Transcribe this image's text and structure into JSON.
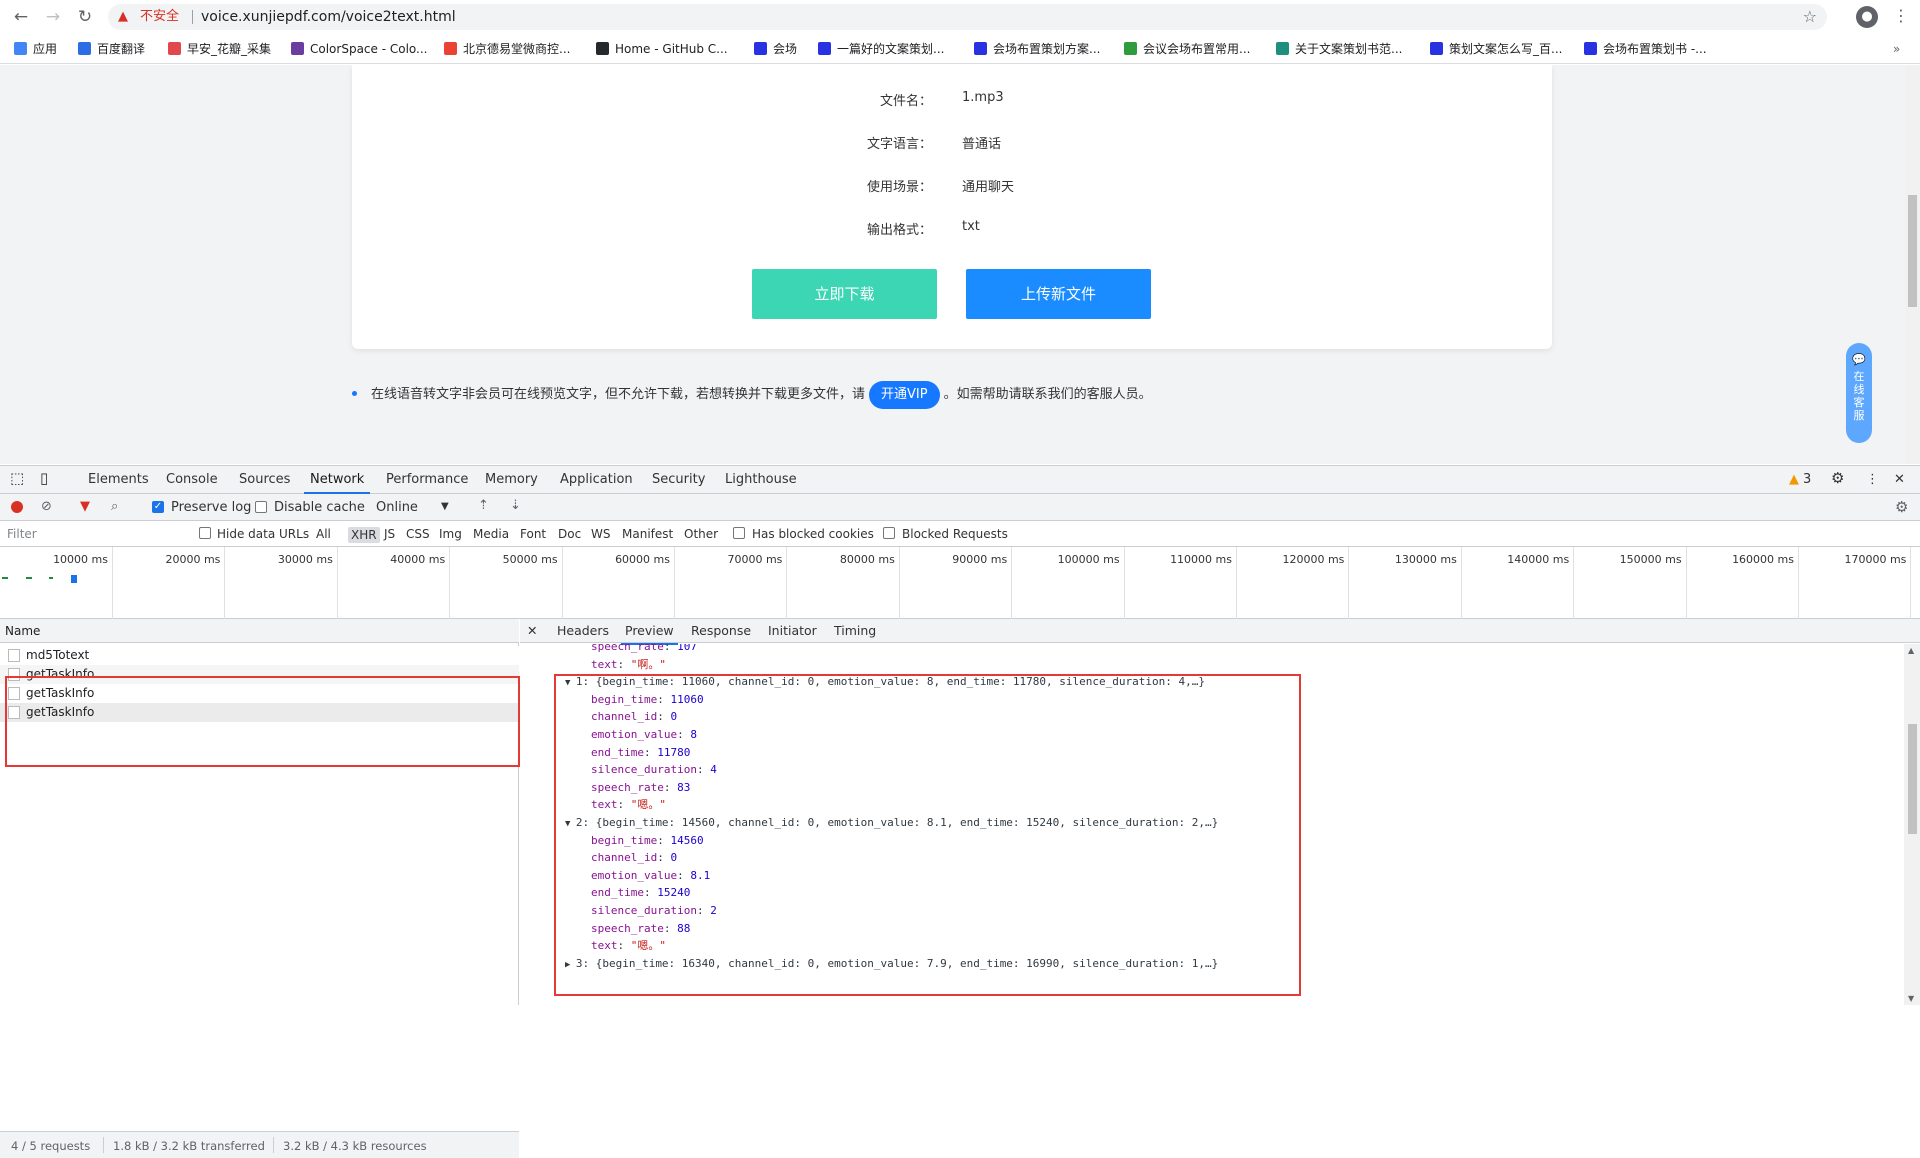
{
  "browser": {
    "not_secure": "不安全",
    "url": "voice.xunjiepdf.com/voice2text.html"
  },
  "bookmarks": [
    {
      "label": "应用",
      "icon": "apps-grid-icon",
      "color": "#4285f4"
    },
    {
      "label": "百度翻译",
      "icon": "baidu-translate-icon",
      "color": "#2b6de5"
    },
    {
      "label": "早安_花瓣_采集",
      "icon": "huaban-icon",
      "color": "#e0484d"
    },
    {
      "label": "ColorSpace - Colo...",
      "icon": "colorspace-icon",
      "color": "#6a3ea1"
    },
    {
      "label": "北京德易堂微商控...",
      "icon": "google-icon",
      "color": "#ea4335"
    },
    {
      "label": "Home - GitHub C...",
      "icon": "github-icon",
      "color": "#24292e"
    },
    {
      "label": "会场",
      "icon": "baidu-paw-icon",
      "color": "#2932e1"
    },
    {
      "label": "一篇好的文案策划...",
      "icon": "baidu-paw-icon",
      "color": "#2932e1"
    },
    {
      "label": "会场布置策划方案...",
      "icon": "baidu-paw-icon",
      "color": "#2932e1"
    },
    {
      "label": "会议会场布置常用...",
      "icon": "doc-green-icon",
      "color": "#2e9c3a"
    },
    {
      "label": "关于文案策划书范...",
      "icon": "doc-teal-icon",
      "color": "#1f8f7d"
    },
    {
      "label": "策划文案怎么写_百...",
      "icon": "baidu-paw-icon",
      "color": "#2932e1"
    },
    {
      "label": "会场布置策划书 -...",
      "icon": "baidu-paw-icon",
      "color": "#2932e1"
    }
  ],
  "card": {
    "rows": [
      {
        "label": "文件名：",
        "value": "1.mp3"
      },
      {
        "label": "文字语言：",
        "value": "普通话"
      },
      {
        "label": "使用场景：",
        "value": "通用聊天"
      },
      {
        "label": "输出格式：",
        "value": "txt"
      }
    ],
    "download_label": "立即下载",
    "upload_label": "上传新文件",
    "download_color": "#3dd6b4",
    "upload_color": "#1a8cff"
  },
  "notice": {
    "before": "在线语音转文字非会员可在线预览文字，但不允许下载，若想转换并下载更多文件，请",
    "vip": "开通VIP",
    "after": "。如需帮助请联系我们的客服人员。"
  },
  "service": {
    "label": "在线客服"
  },
  "devtools": {
    "tabs": [
      "Elements",
      "Console",
      "Sources",
      "Network",
      "Performance",
      "Memory",
      "Application",
      "Security",
      "Lighthouse"
    ],
    "active_tab": "Network",
    "warning_count": "3",
    "preserve_log": "Preserve log",
    "disable_cache": "Disable cache",
    "throttle": "Online",
    "filter_placeholder": "Filter",
    "hide_data_urls": "Hide data URLs",
    "filter_types": [
      "All",
      "XHR",
      "JS",
      "CSS",
      "Img",
      "Media",
      "Font",
      "Doc",
      "WS",
      "Manifest",
      "Other"
    ],
    "has_blocked_cookies": "Has blocked cookies",
    "blocked_requests": "Blocked Requests",
    "timeline_ticks": [
      "10000 ms",
      "20000 ms",
      "30000 ms",
      "40000 ms",
      "50000 ms",
      "60000 ms",
      "70000 ms",
      "80000 ms",
      "90000 ms",
      "100000 ms",
      "110000 ms",
      "120000 ms",
      "130000 ms",
      "140000 ms",
      "150000 ms",
      "160000 ms",
      "170000 ms"
    ],
    "name_header": "Name",
    "requests": [
      "md5Totext",
      "getTaskInfo",
      "getTaskInfo",
      "getTaskInfo"
    ],
    "status": {
      "requests": "4 / 5 requests",
      "transferred": "1.8 kB / 3.2 kB transferred",
      "resources": "3.2 kB / 4.3 kB resources"
    },
    "detail_tabs": [
      "Headers",
      "Preview",
      "Response",
      "Initiator",
      "Timing"
    ],
    "active_detail_tab": "Preview",
    "preview": {
      "prev_tail": [
        {
          "key": "speech_rate",
          "value": "107",
          "kind": "n"
        },
        {
          "key": "text",
          "value": "\"啊。\"",
          "kind": "s"
        }
      ],
      "items": [
        {
          "summary": "1: {begin_time: 11060, channel_id: 0, emotion_value: 8, end_time: 11780, silence_duration: 4,…}",
          "fields": [
            {
              "key": "begin_time",
              "value": "11060",
              "kind": "n"
            },
            {
              "key": "channel_id",
              "value": "0",
              "kind": "n"
            },
            {
              "key": "emotion_value",
              "value": "8",
              "kind": "n"
            },
            {
              "key": "end_time",
              "value": "11780",
              "kind": "n"
            },
            {
              "key": "silence_duration",
              "value": "4",
              "kind": "n"
            },
            {
              "key": "speech_rate",
              "value": "83",
              "kind": "n"
            },
            {
              "key": "text",
              "value": "\"嗯。\"",
              "kind": "s"
            }
          ]
        },
        {
          "summary": "2: {begin_time: 14560, channel_id: 0, emotion_value: 8.1, end_time: 15240, silence_duration: 2,…}",
          "fields": [
            {
              "key": "begin_time",
              "value": "14560",
              "kind": "n"
            },
            {
              "key": "channel_id",
              "value": "0",
              "kind": "n"
            },
            {
              "key": "emotion_value",
              "value": "8.1",
              "kind": "n"
            },
            {
              "key": "end_time",
              "value": "15240",
              "kind": "n"
            },
            {
              "key": "silence_duration",
              "value": "2",
              "kind": "n"
            },
            {
              "key": "speech_rate",
              "value": "88",
              "kind": "n"
            },
            {
              "key": "text",
              "value": "\"嗯。\"",
              "kind": "s"
            }
          ]
        }
      ],
      "next_summary": "3: {begin_time: 16340, channel_id: 0, emotion_value: 7.9, end_time: 16990, silence_duration: 1,…}"
    }
  }
}
